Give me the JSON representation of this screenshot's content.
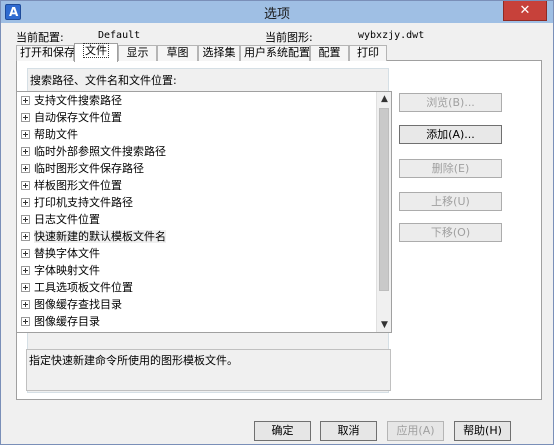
{
  "window": {
    "title": "选项",
    "close_glyph": "✕",
    "app_icon_glyph": "A"
  },
  "info": {
    "current_profile_label": "当前配置:",
    "current_profile_value": "Default",
    "current_drawing_label": "当前图形:",
    "current_drawing_value": "wybxzjy.dwt"
  },
  "tabs": [
    {
      "label": "打开和保存"
    },
    {
      "label": "文件"
    },
    {
      "label": "显示"
    },
    {
      "label": "草图"
    },
    {
      "label": "选择集"
    },
    {
      "label": "用户系统配置"
    },
    {
      "label": "配置"
    },
    {
      "label": "打印"
    }
  ],
  "active_tab": "文件",
  "group": {
    "label": "搜索路径、文件名和文件位置:"
  },
  "tree": {
    "items": [
      {
        "label": "支持文件搜索路径"
      },
      {
        "label": "自动保存文件位置"
      },
      {
        "label": "帮助文件"
      },
      {
        "label": "临时外部参照文件搜索路径"
      },
      {
        "label": "临时图形文件保存路径"
      },
      {
        "label": "样板图形文件位置"
      },
      {
        "label": "打印机支持文件路径"
      },
      {
        "label": "日志文件位置"
      },
      {
        "label": "快速新建的默认模板文件名"
      },
      {
        "label": "替换字体文件"
      },
      {
        "label": "字体映射文件"
      },
      {
        "label": "工具选项板文件位置"
      },
      {
        "label": "图像缓存查找目录"
      },
      {
        "label": "图像缓存目录"
      }
    ],
    "selected": "快速新建的默认模板文件名"
  },
  "scroll": {
    "up_glyph": "▲",
    "down_glyph": "▼"
  },
  "side_buttons": {
    "browse": "浏览(B)...",
    "add": "添加(A)...",
    "delete": "删除(E)",
    "move_up": "上移(U)",
    "move_down": "下移(O)"
  },
  "description": "指定快速新建命令所使用的图形模板文件。",
  "bottom_buttons": {
    "ok": "确定",
    "cancel": "取消",
    "apply": "应用(A)",
    "help": "帮助(H)"
  },
  "colors": {
    "titlebar": "#9fbfe4",
    "close": "#c7413a"
  }
}
